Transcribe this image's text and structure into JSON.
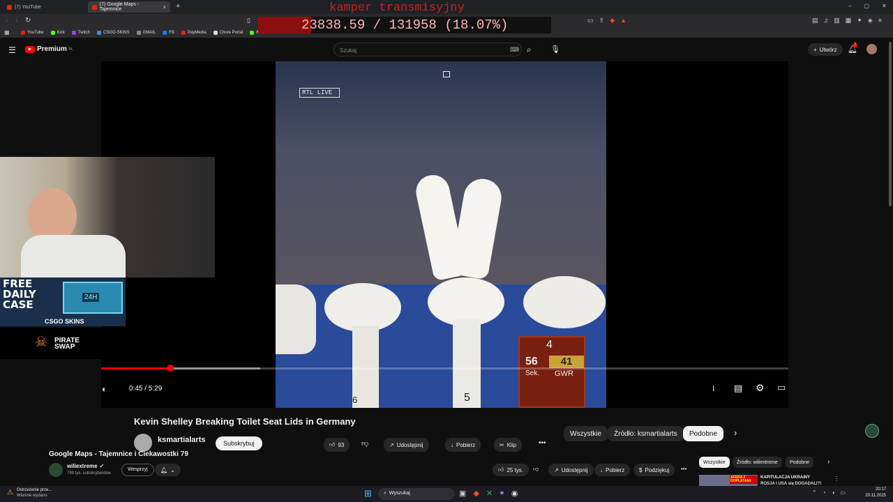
{
  "browser": {
    "tabs": [
      {
        "label": "(7) YouTube"
      },
      {
        "label": "(7) Google Maps - Tajemnice",
        "active": true
      }
    ],
    "bookmarks": [
      "YouTube",
      "Kick",
      "Twitch",
      "CSGO-SKINS",
      "GMAIL",
      "FB",
      "PayMedia",
      "Chure Portal",
      "Kick"
    ]
  },
  "stream_overlay": {
    "title": "kamper transmisyjny",
    "counter": "23838.59 / 131958 (18.07%)",
    "progress_fraction": 0.1807
  },
  "youtube": {
    "logo_text": "Premium",
    "logo_sup": "PL",
    "search_placeholder": "Szukaj",
    "create_label": "Utwórz",
    "notif_count": "7"
  },
  "video": {
    "overlay_logo": "RTL LIVE",
    "score_top": "4",
    "score_left": "56",
    "score_left_sub": "Sek.",
    "score_right": "41",
    "score_right_sub": "GWR",
    "lane_a": "6",
    "lane_b": "5",
    "time": "0:45 / 5:29",
    "progress_fraction": 0.1
  },
  "embedded": {
    "title": "Kevin Shelley Breaking Toilet Seat Lids in Germany",
    "channel": "ksmartialarts",
    "subscribe": "Subskrybuj",
    "likes": "93",
    "share": "Udostępnij",
    "download": "Pobierz",
    "clip": "Klip",
    "chips": [
      "Wszystkie",
      "Źródło: ksmartialarts",
      "Podobne"
    ]
  },
  "ads": {
    "free_daily_case": "FREE DAILY CASE",
    "case_label": "24H",
    "csgo_skins": "CSGO SKINS",
    "pirate_swap": "PIRATE SWAP"
  },
  "watch": {
    "title": "Google Maps - Tajemnice i Ciekawostki 79",
    "channel": "wiliextreme",
    "subs": "799 tys. subskrybentów",
    "support": "Wesprzyj",
    "likes": "25 tys.",
    "share": "Udostępnij",
    "download": "Pobierz",
    "thanks": "Podziękuj",
    "chips": [
      "Wszystkie",
      "Źródło: wiliextreme",
      "Podobne"
    ],
    "rec_thumb_text": "AFERA Z DOPŁATAMI",
    "rec_title": "KAPITULACJA UKRAINY",
    "rec_title2": "ROSJA I USA się DOGADALI?!"
  },
  "taskbar": {
    "notification_title": "Ostrzeżenie prze...",
    "notification_sub": "Właśnie wydano",
    "search": "Wyszukaj",
    "time": "20:17",
    "date": "20.11.2025"
  },
  "colors": {
    "accent": "#ff0000",
    "overlay_red": "#c8202a"
  }
}
